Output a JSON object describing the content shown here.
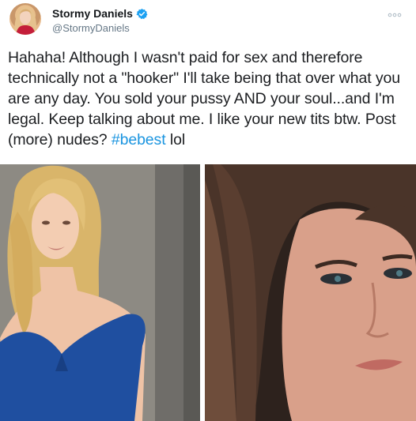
{
  "tweet": {
    "display_name": "Stormy Daniels",
    "handle": "@StormyDaniels",
    "text_before_hashtag": "Hahaha! Although I wasn't paid for sex and therefore technically not a \"hooker\" I'll take being that over what you are any day. You sold your pussy AND your soul...and I'm legal. Keep talking about me. I like your new tits btw. Post (more) nudes? ",
    "hashtag": "#bebest",
    "text_after_hashtag": " lol"
  },
  "icons": {
    "verified": "verified-badge-icon",
    "more": "more-options-icon"
  },
  "colors": {
    "hashtag": "#1b95e0",
    "verified": "#1da1f2",
    "handle": "#657786"
  }
}
